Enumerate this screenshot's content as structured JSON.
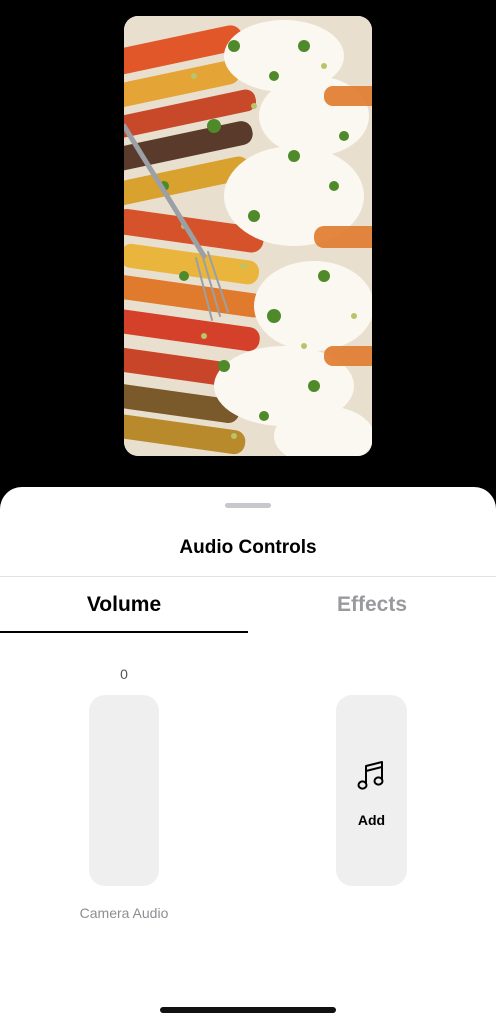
{
  "preview": {
    "image_description_icon": "food-photo-icon"
  },
  "sheet": {
    "title": "Audio Controls"
  },
  "tabs": [
    {
      "label": "Volume",
      "selected": true
    },
    {
      "label": "Effects",
      "selected": false
    }
  ],
  "volume": {
    "value": "0",
    "level_fraction": 0,
    "caption": "Camera Audio"
  },
  "add_music": {
    "icon": "music-note-icon",
    "label": "Add"
  },
  "colors": {
    "accent": "#000000",
    "inactive_tab": "#9a9a9e",
    "tile_bg": "#efefef"
  }
}
